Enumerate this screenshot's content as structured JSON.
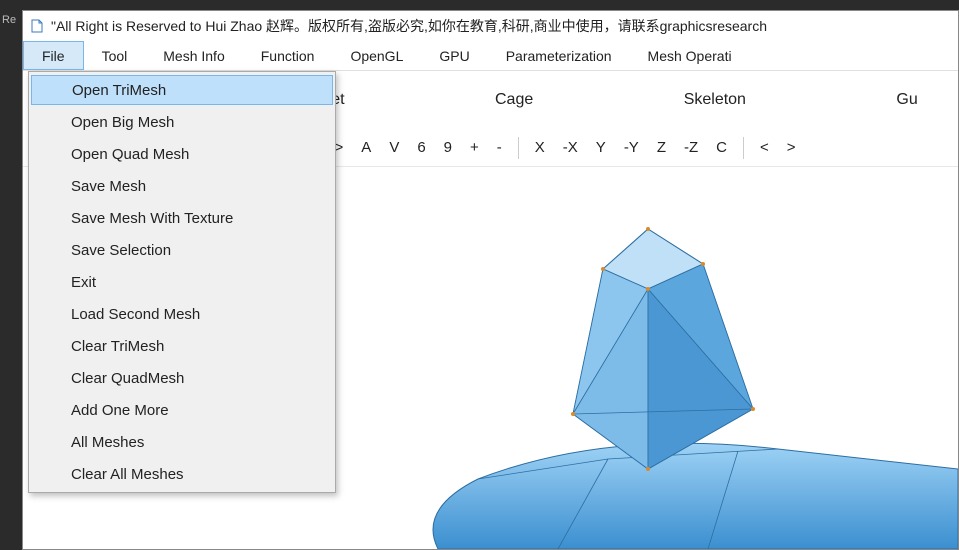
{
  "chrome": {
    "left_label": "Re"
  },
  "titlebar": {
    "text": "\"All Right is Reserved to Hui Zhao 赵辉。版权所有,盗版必究,如你在教育,科研,商业中使用，请联系graphicsresearch"
  },
  "menubar": {
    "items": [
      "File",
      "Tool",
      "Mesh Info",
      "Function",
      "OpenGL",
      "GPU",
      "Parameterization",
      "Mesh Operati"
    ],
    "active_index": 0
  },
  "file_menu": {
    "items": [
      "Open TriMesh",
      "Open Big Mesh",
      "Open Quad Mesh",
      "Save Mesh",
      "Save Mesh With Texture",
      "Save Selection",
      "Exit",
      "Load Second Mesh",
      "Clear TriMesh",
      "Clear QuadMesh",
      "Add One More",
      "All Meshes",
      "Clear All Meshes"
    ],
    "highlight_index": 0
  },
  "subtoolbar": {
    "items": [
      "Tet",
      "Cage",
      "Skeleton",
      "Gu"
    ]
  },
  "btnbar": {
    "buttons": [
      "<",
      ">>",
      "A",
      "V",
      "6",
      "9",
      "+",
      "-",
      "|",
      "X",
      "-X",
      "Y",
      "-Y",
      "Z",
      "-Z",
      "C",
      "|",
      "<",
      ">"
    ]
  }
}
